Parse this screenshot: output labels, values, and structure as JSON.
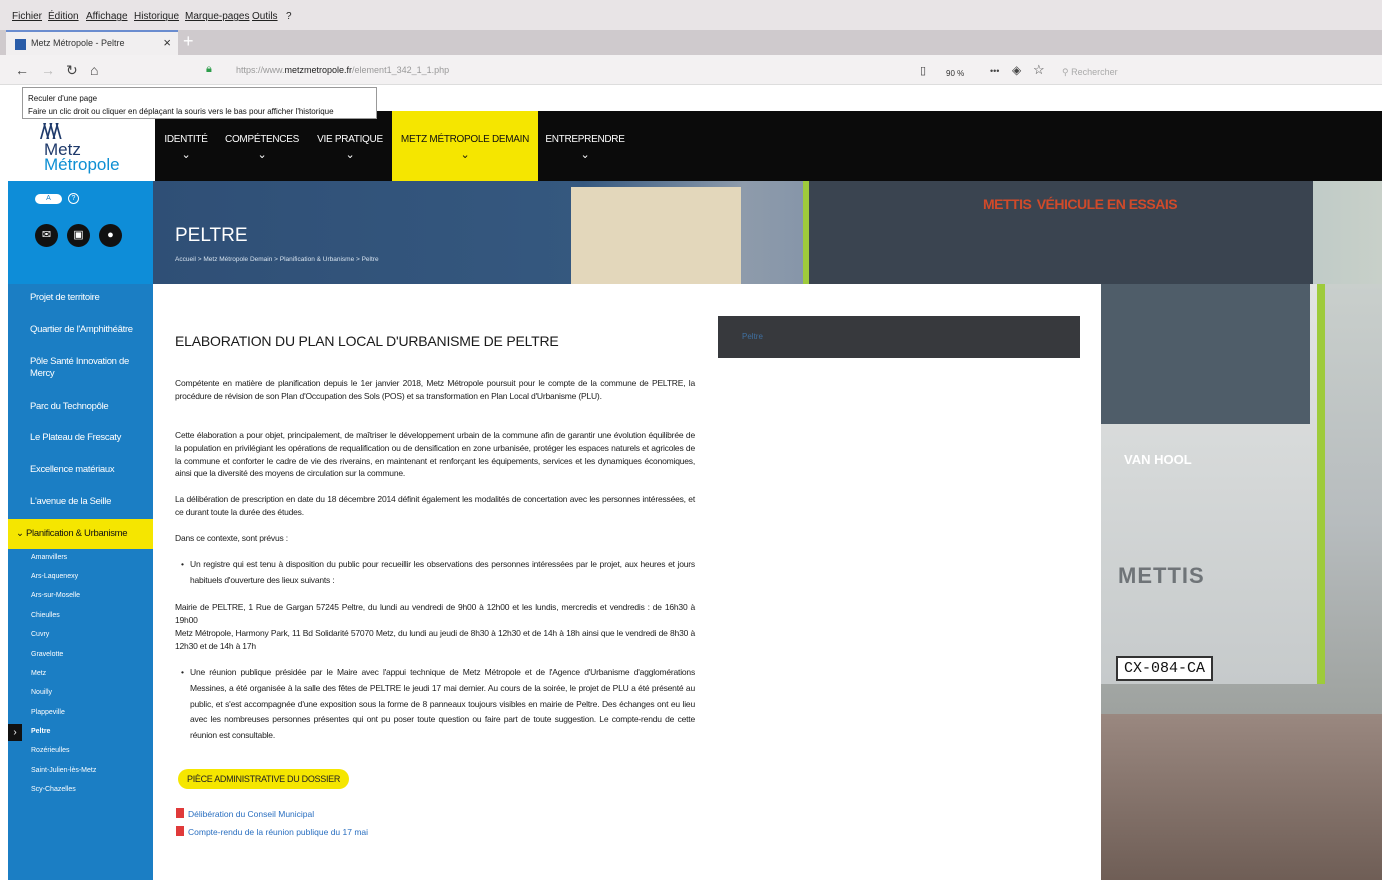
{
  "browser": {
    "menu": [
      "Fichier",
      "Édition",
      "Affichage",
      "Historique",
      "Marque-pages",
      "Outils",
      "?"
    ],
    "tab_title": "Metz Métropole - Peltre",
    "new_tab": "+",
    "close": "×",
    "url_prefix": "https://www.",
    "url_domain": "metzmetropole.fr",
    "url_rest": "/element1_342_1_1.php",
    "zoom": "90 %",
    "more": "•••",
    "search_placeholder": "Rechercher",
    "tooltip_line1": "Reculer d'une page",
    "tooltip_line2": "Faire un clic droit ou cliquer en déplaçant la souris vers le bas pour afficher l'historique"
  },
  "logo": {
    "line1": "Metz",
    "line2": "Métropole"
  },
  "nav": [
    {
      "label": "IDENTITÉ"
    },
    {
      "label": "COMPÉTENCES"
    },
    {
      "label": "VIE PRATIQUE"
    },
    {
      "label": "METZ MÉTROPOLE DEMAIN"
    },
    {
      "label": "ENTREPRENDRE"
    }
  ],
  "sidebar": {
    "toggle": "A",
    "help": "?",
    "links": [
      "Projet de territoire",
      "Quartier de l'Amphithéâtre",
      "Pôle Santé Innovation de Mercy",
      "Parc du Technopôle",
      "Le Plateau de Frescaty",
      "Excellence matériaux",
      "L'avenue de la Seille"
    ],
    "active": "Planification & Urbanisme",
    "subitems": [
      "Amanvillers",
      "Ars-Laquenexy",
      "Ars-sur-Moselle",
      "Chieulles",
      "Cuvry",
      "Gravelotte",
      "Metz",
      "Nouilly",
      "Plappeville",
      "Peltre",
      "Rozérieulles",
      "Saint-Julien-lès-Metz",
      "Scy-Chazelles"
    ]
  },
  "hero": {
    "title": "PELTRE",
    "breadcrumb": "Accueil > Metz Métropole Demain > Planification & Urbanisme > Peltre",
    "bus_sign": "METTIS",
    "bus_sign_sub": "VÉHICULE EN ESSAIS",
    "bus_brand": "VAN HOOL",
    "bus_name": "METTIS",
    "plate": "CX-084-CA"
  },
  "content": {
    "heading": "ELABORATION DU PLAN LOCAL D'URBANISME DE PELTRE",
    "p1": "Compétente en matière de planification depuis le 1er janvier 2018, Metz Métropole poursuit pour le compte de la commune de PELTRE, la procédure de révision de son Plan d'Occupation des Sols (POS) et sa transformation en Plan Local d'Urbanisme (PLU).",
    "p2": "Cette élaboration a pour objet, principalement, de maîtriser le développement urbain de la commune afin de garantir une évolution équilibrée de la population en privilégiant les opérations de requalification ou de densification en zone urbanisée, protéger les espaces naturels et agricoles de la commune et conforter le cadre de vie des riverains, en maintenant et renforçant les équipements, services et les dynamiques économiques, ainsi que la diversité des moyens de circulation sur la commune.",
    "p3": "La délibération de prescription en date du 18 décembre 2014 définit également les modalités de concertation avec les personnes intéressées, et ce durant toute la durée des études.",
    "p4": "Dans ce contexte, sont prévus :",
    "bullet1": "Un registre qui est tenu à disposition du public pour recueillir les observations des personnes intéressées par le projet, aux heures et jours habituels d'ouverture des lieux suivants :",
    "p5": "Mairie de PELTRE, 1 Rue de Gargan 57245 Peltre, du lundi au vendredi de 9h00 à 12h00 et les lundis, mercredis et vendredis : de 16h30 à 19h00",
    "p6": "Metz Métropole, Harmony Park, 11 Bd Solidarité 57070 Metz, du lundi au jeudi de 8h30 à 12h30 et de 14h à 18h ainsi que le vendredi de 8h30 à 12h30 et de 14h à 17h",
    "bullet2": "Une réunion publique présidée par le Maire avec l'appui technique de Metz Métropole et de l'Agence d'Urbanisme d'agglomérations Messines, a été organisée à la salle des fêtes de PELTRE le jeudi 17 mai dernier. Au cours de la soirée, le projet de PLU a été présenté au public, et s'est accompagnée d'une exposition sous la forme de 8 panneaux toujours visibles en mairie de Peltre. Des échanges ont eu lieu avec les nombreuses personnes présentes qui ont pu poser toute question ou faire part de toute suggestion. Le compte-rendu de cette réunion est consultable.",
    "dossier_label": "PIÈCE ADMINISTRATIVE DU DOSSIER",
    "docs": [
      "Délibération du Conseil Municipal",
      "Compte-rendu de la réunion publique du 17 mai"
    ],
    "side_box": "Peltre"
  }
}
